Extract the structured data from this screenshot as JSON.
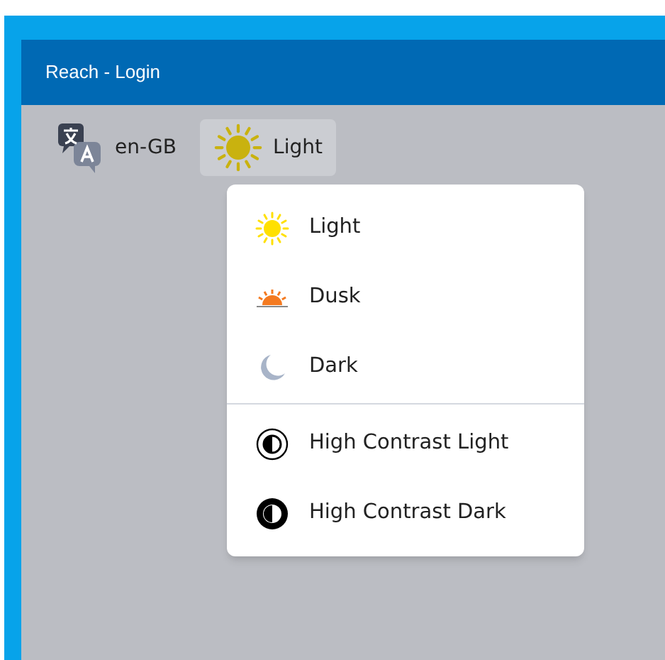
{
  "window": {
    "title": "Reach - Login"
  },
  "toolbar": {
    "language": {
      "label": "en-GB"
    },
    "theme": {
      "label": "Light",
      "kind": "light",
      "open": true
    }
  },
  "theme_menu": {
    "groups": [
      [
        {
          "label": "Light",
          "kind": "light"
        },
        {
          "label": "Dusk",
          "kind": "dusk"
        },
        {
          "label": "Dark",
          "kind": "dark"
        }
      ],
      [
        {
          "label": "High Contrast Light",
          "kind": "hc-light"
        },
        {
          "label": "High Contrast Dark",
          "kind": "hc-dark"
        }
      ]
    ]
  }
}
